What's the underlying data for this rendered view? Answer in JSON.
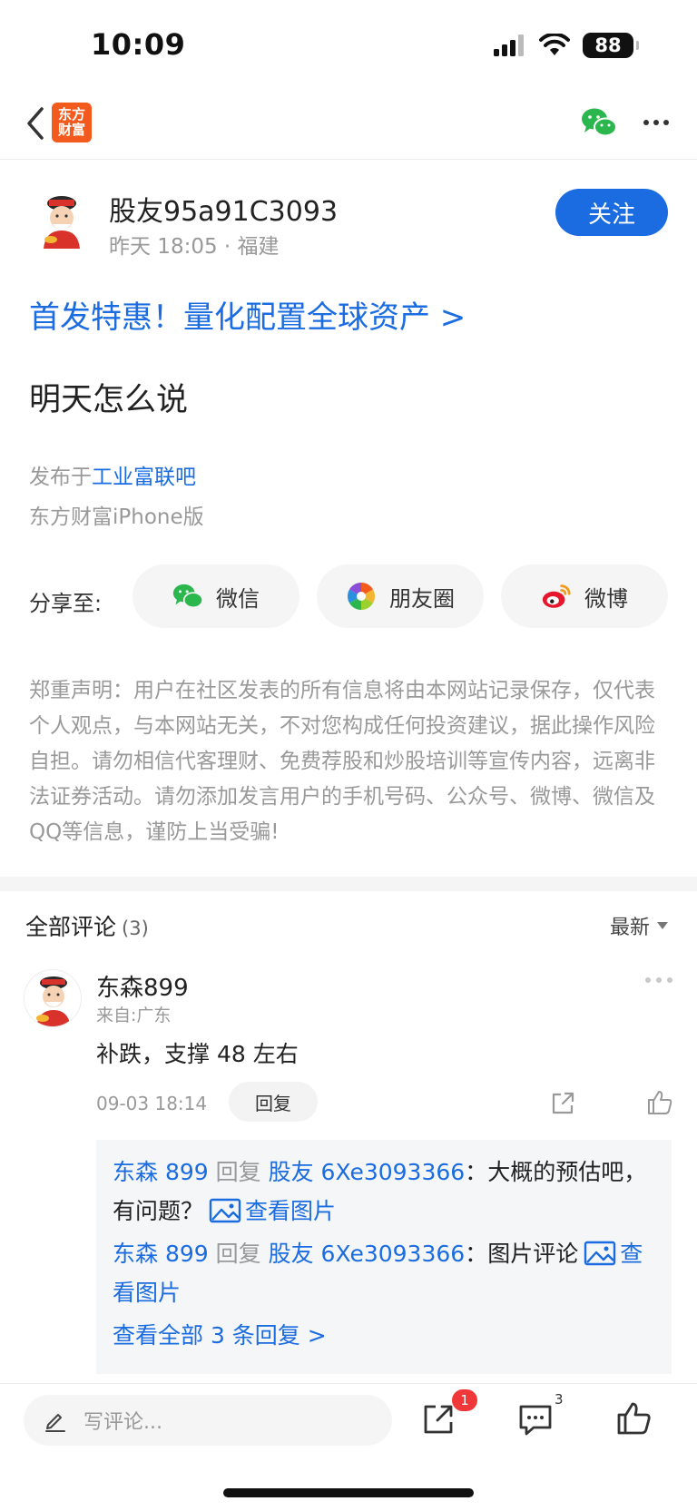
{
  "status_bar": {
    "time": "10:09",
    "battery": "88"
  },
  "nav": {
    "app_logo_text": "东方财富"
  },
  "author": {
    "name": "股友95a91C3093",
    "meta": "昨天 18:05 · 福建",
    "follow_label": "关注"
  },
  "ad_link": "首发特惠！量化配置全球资产 >",
  "post": {
    "title": "明天怎么说",
    "posted_in_prefix": "发布于",
    "forum": "工业富联吧",
    "device": "东方财富iPhone版"
  },
  "share": {
    "label": "分享至:",
    "options": [
      {
        "label": "微信",
        "icon": "wechat-icon"
      },
      {
        "label": "朋友圈",
        "icon": "moments-icon"
      },
      {
        "label": "微博",
        "icon": "weibo-icon"
      }
    ]
  },
  "disclaimer": "郑重声明：用户在社区发表的所有信息将由本网站记录保存，仅代表个人观点，与本网站无关，不对您构成任何投资建议，据此操作风险自担。请勿相信代客理财、免费荐股和炒股培训等宣传内容，远离非法证券活动。请勿添加发言用户的手机号码、公众号、微博、微信及QQ等信息，谨防上当受骗!",
  "comments": {
    "title": "全部评论",
    "count": "(3)",
    "sort_label": "最新",
    "items": [
      {
        "name": "东森899",
        "from": "来自:广东",
        "text": "补跌，支撑 48 左右",
        "time": "09-03 18:14",
        "reply_label": "回复",
        "replies": [
          {
            "author": "东森 899",
            "verb": "回复",
            "target": "股友 6Xe3093366",
            "sep": "：",
            "text": "大概的预估吧，有问题？",
            "view_image": "查看图片"
          },
          {
            "author": "东森 899",
            "verb": "回复",
            "target": "股友 6Xe3093366",
            "sep": "：",
            "text": "图片评论",
            "view_image": "查看图片"
          }
        ],
        "view_all": "查看全部 3 条回复 >"
      }
    ]
  },
  "bottom_bar": {
    "input_placeholder": "写评论...",
    "share_badge": "1",
    "comment_count": "3"
  },
  "colors": {
    "accent": "#1a6ce0",
    "badge": "#f0383b",
    "logo": "#f25a1e",
    "wechat": "#2bb74d"
  }
}
